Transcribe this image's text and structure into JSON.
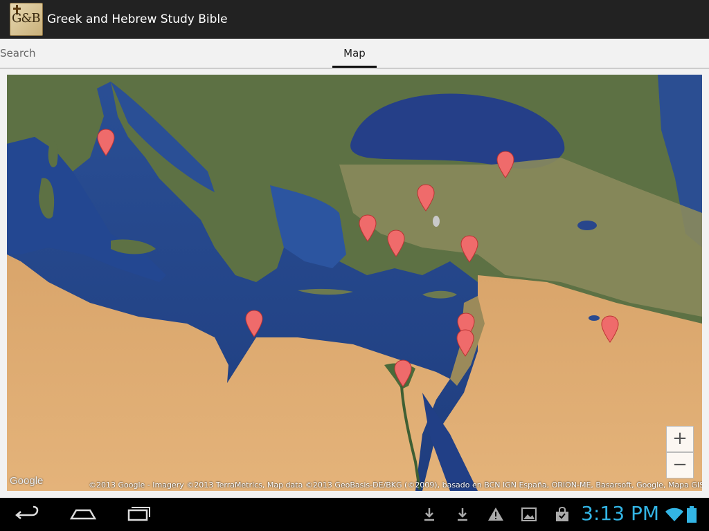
{
  "app": {
    "title": "Greek and Hebrew Study Bible",
    "icon_text": "G&B"
  },
  "tabs": [
    {
      "label": "Search",
      "selected": false
    },
    {
      "label": "Map",
      "selected": true
    }
  ],
  "map": {
    "type": "satellite",
    "google_logo": "Google",
    "attribution": "©2013 Google - Imagery ©2013 TerraMetrics, Map data ©2013 GeoBasis-DE/BKG (©2009), basado en BCN IGN España, ORION-ME, Basarsoft, Google, Mapa GISrael",
    "zoom_in_label": "+",
    "zoom_out_label": "−",
    "marker_count": 11,
    "marker_color": "#ef6b6b"
  },
  "system_bar": {
    "clock": "3:13 PM",
    "clock_color": "#33b5e5",
    "nav": [
      "back-icon",
      "home-icon",
      "recent-apps-icon"
    ],
    "status_icons": [
      "download-icon",
      "download-icon",
      "warning-icon",
      "image-icon",
      "shopping-bag-icon",
      "wifi-icon",
      "battery-icon"
    ]
  }
}
